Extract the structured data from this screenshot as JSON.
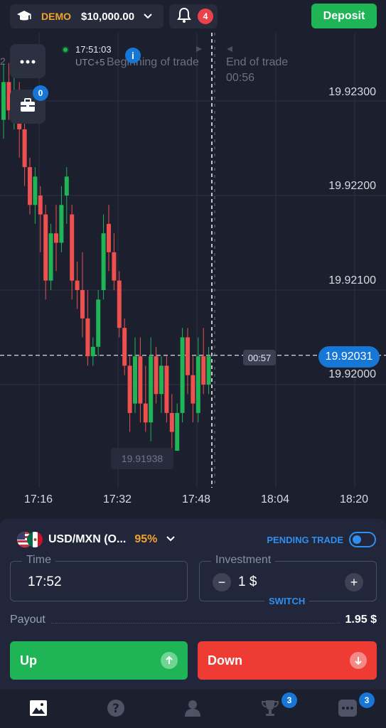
{
  "header": {
    "account_type": "DEMO",
    "balance": "$10,000.00",
    "notifications_count": "4",
    "deposit_label": "Deposit"
  },
  "chart": {
    "clock_time": "17:51:03",
    "timezone": "UTC+5",
    "beginning_label": "Beginning of trade",
    "end_label": "End of trade",
    "end_countdown": "00:56",
    "left_edge_digit": "2",
    "portfolio_count": "0",
    "price_levels": [
      "19.92300",
      "19.92200",
      "19.92100",
      "19.92000"
    ],
    "time_labels": [
      "17:16",
      "17:32",
      "17:48",
      "18:04",
      "18:20"
    ],
    "current_price": "19.92031",
    "current_timer": "00:57",
    "low_price": "19.91938",
    "colors": {
      "up": "#1fb455",
      "down": "#ee4f4f",
      "accent": "#1677d6"
    }
  },
  "chart_data": {
    "type": "candlestick",
    "ylim": [
      19.9184,
      19.9236
    ],
    "candles": [
      {
        "o": 19.9228,
        "c": 19.9232,
        "h": 19.9234,
        "l": 19.9226
      },
      {
        "o": 19.9232,
        "c": 19.9229,
        "h": 19.9234,
        "l": 19.9228
      },
      {
        "o": 19.9229,
        "c": 19.9231,
        "h": 19.9233,
        "l": 19.9227
      },
      {
        "o": 19.9229,
        "c": 19.9227,
        "h": 19.9232,
        "l": 19.9224
      },
      {
        "o": 19.9227,
        "c": 19.9223,
        "h": 19.9228,
        "l": 19.9221
      },
      {
        "o": 19.9223,
        "c": 19.9219,
        "h": 19.9224,
        "l": 19.9218
      },
      {
        "o": 19.9219,
        "c": 19.9222,
        "h": 19.9223,
        "l": 19.9217
      },
      {
        "o": 19.922,
        "c": 19.9218,
        "h": 19.9221,
        "l": 19.9214
      },
      {
        "o": 19.9218,
        "c": 19.9211,
        "h": 19.9219,
        "l": 19.9209
      },
      {
        "o": 19.9211,
        "c": 19.9216,
        "h": 19.9217,
        "l": 19.921
      },
      {
        "o": 19.9216,
        "c": 19.9215,
        "h": 19.9219,
        "l": 19.9212
      },
      {
        "o": 19.9215,
        "c": 19.9219,
        "h": 19.9221,
        "l": 19.9214
      },
      {
        "o": 19.922,
        "c": 19.9222,
        "h": 19.9223,
        "l": 19.9217
      },
      {
        "o": 19.9218,
        "c": 19.9211,
        "h": 19.9219,
        "l": 19.9209
      },
      {
        "o": 19.9211,
        "c": 19.921,
        "h": 19.9213,
        "l": 19.9208
      },
      {
        "o": 19.921,
        "c": 19.9207,
        "h": 19.9214,
        "l": 19.9205
      },
      {
        "o": 19.9207,
        "c": 19.9203,
        "h": 19.921,
        "l": 19.9202
      },
      {
        "o": 19.9203,
        "c": 19.9204,
        "h": 19.9205,
        "l": 19.9202
      },
      {
        "o": 19.9204,
        "c": 19.9209,
        "h": 19.921,
        "l": 19.9203
      },
      {
        "o": 19.921,
        "c": 19.9216,
        "h": 19.9218,
        "l": 19.9209
      },
      {
        "o": 19.9217,
        "c": 19.9214,
        "h": 19.9219,
        "l": 19.9212
      },
      {
        "o": 19.9214,
        "c": 19.9211,
        "h": 19.9216,
        "l": 19.921
      },
      {
        "o": 19.9211,
        "c": 19.9206,
        "h": 19.9212,
        "l": 19.9205
      },
      {
        "o": 19.9206,
        "c": 19.9202,
        "h": 19.9207,
        "l": 19.9201
      },
      {
        "o": 19.9202,
        "c": 19.9197,
        "h": 19.9203,
        "l": 19.9195
      },
      {
        "o": 19.9198,
        "c": 19.9203,
        "h": 19.9205,
        "l": 19.9197
      },
      {
        "o": 19.9203,
        "c": 19.9198,
        "h": 19.9205,
        "l": 19.9196
      },
      {
        "o": 19.9198,
        "c": 19.9196,
        "h": 19.9202,
        "l": 19.9195
      },
      {
        "o": 19.9196,
        "c": 19.9203,
        "h": 19.9205,
        "l": 19.9194
      },
      {
        "o": 19.9203,
        "c": 19.9199,
        "h": 19.9204,
        "l": 19.9198
      },
      {
        "o": 19.9199,
        "c": 19.9202,
        "h": 19.9203,
        "l": 19.9197
      },
      {
        "o": 19.9202,
        "c": 19.9197,
        "h": 19.9203,
        "l": 19.9196
      },
      {
        "o": 19.9197,
        "c": 19.9195,
        "h": 19.9199,
        "l": 19.9193
      },
      {
        "o": 19.9193,
        "c": 19.9197,
        "h": 19.9198,
        "l": 19.9193
      },
      {
        "o": 19.9197,
        "c": 19.9205,
        "h": 19.9206,
        "l": 19.9196
      },
      {
        "o": 19.9205,
        "c": 19.9201,
        "h": 19.9206,
        "l": 19.9199
      },
      {
        "o": 19.9201,
        "c": 19.9198,
        "h": 19.9203,
        "l": 19.9196
      },
      {
        "o": 19.9197,
        "c": 19.9203,
        "h": 19.9205,
        "l": 19.9196
      },
      {
        "o": 19.9203,
        "c": 19.92,
        "h": 19.9206,
        "l": 19.9199
      },
      {
        "o": 19.92,
        "c": 19.9203,
        "h": 19.9204,
        "l": 19.9199
      }
    ]
  },
  "trade": {
    "asset": "USD/MXN (O...",
    "payout_percent": "95%",
    "pending_label": "PENDING TRADE",
    "time_label": "Time",
    "time_value": "17:52",
    "investment_label": "Investment",
    "investment_value": "1 $",
    "minus_label": "−",
    "plus_label": "+",
    "switch_label": "SWITCH",
    "payout_label": "Payout",
    "payout_value": "1.95 $",
    "up_label": "Up",
    "down_label": "Down",
    "colors": {
      "up": "#1fb455",
      "down": "#ee3b34"
    }
  },
  "nav": {
    "tournaments_badge": "3",
    "more_badge": "3"
  }
}
